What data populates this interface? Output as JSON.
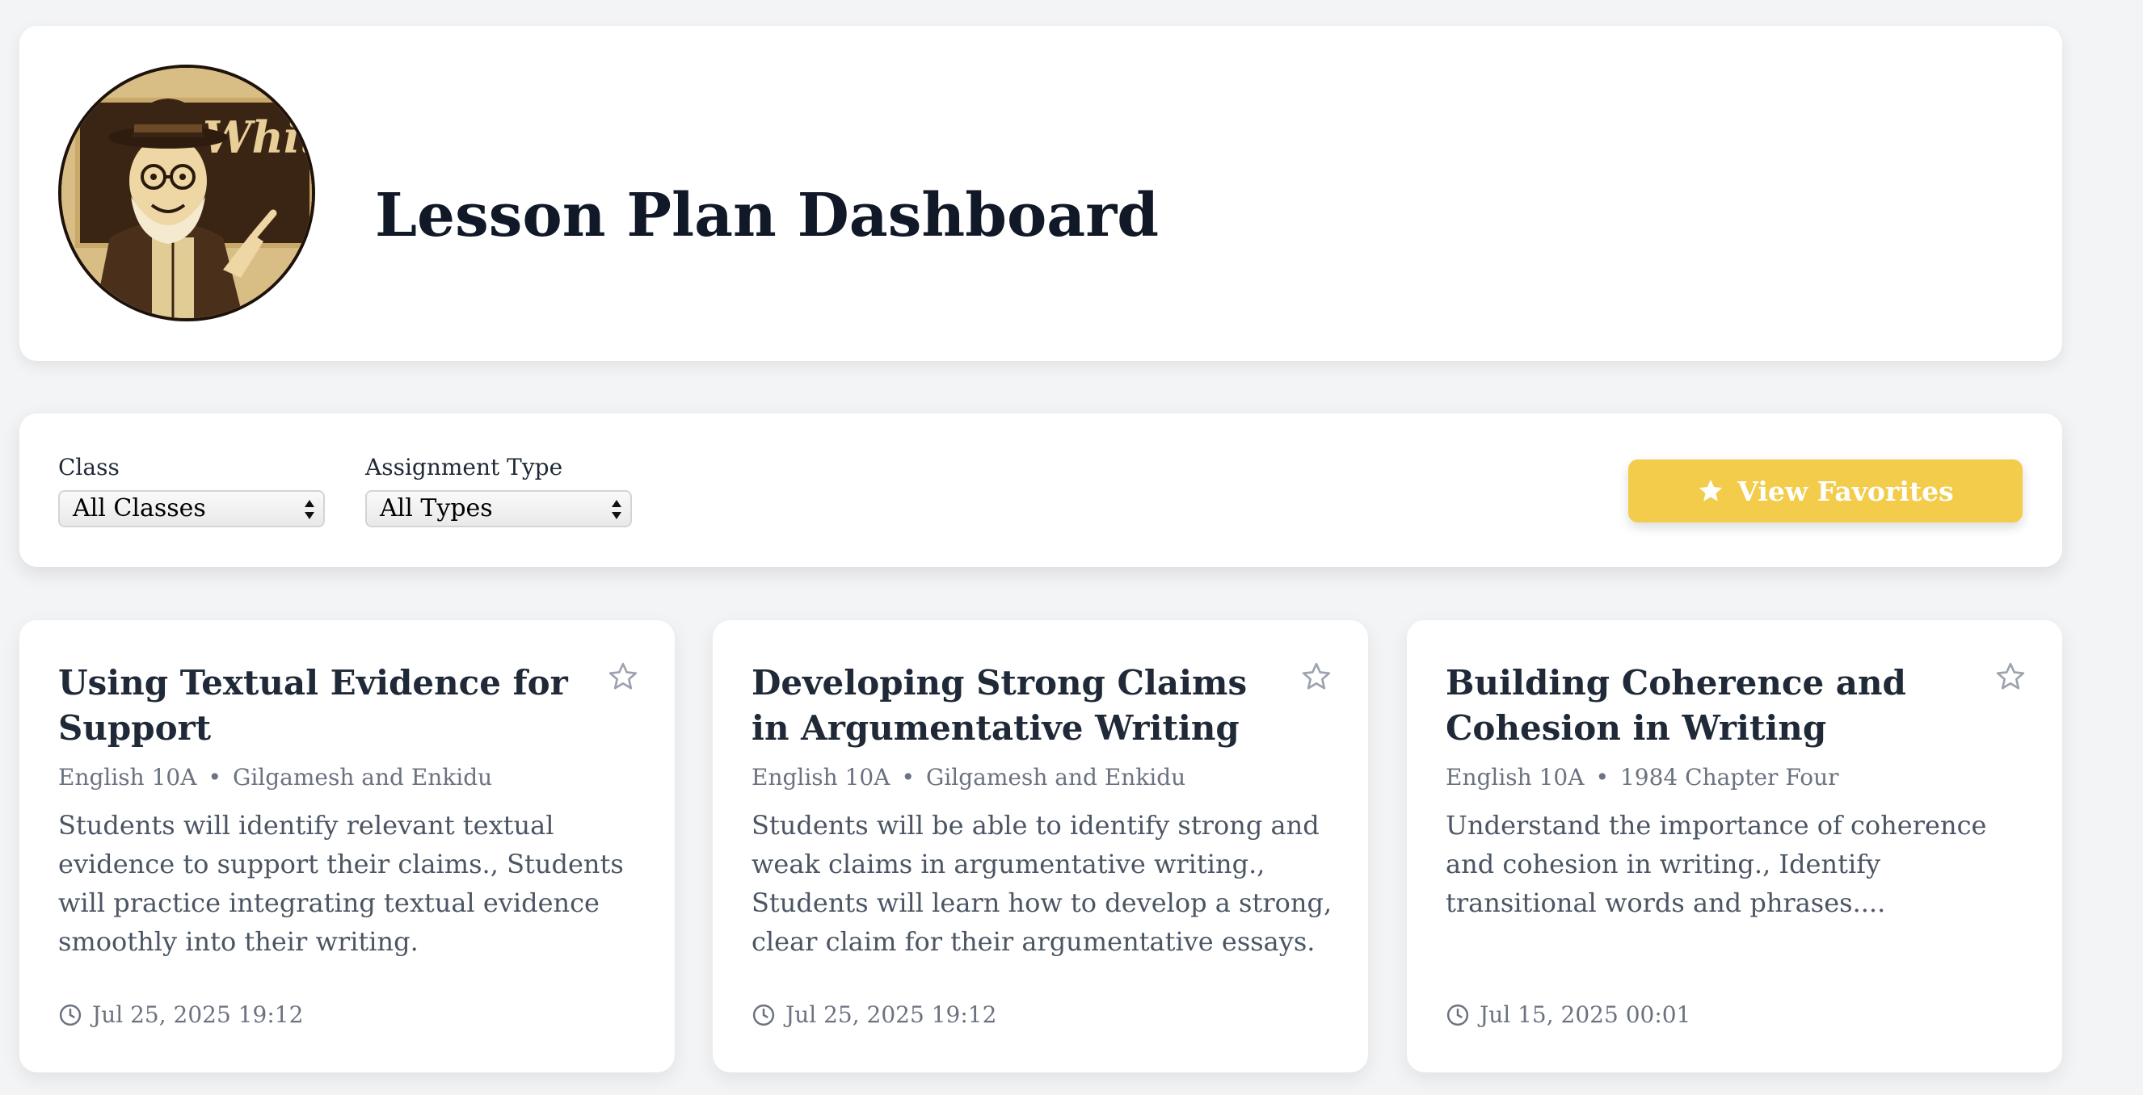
{
  "header": {
    "title": "Lesson Plan Dashboard",
    "logo_text": "Whit"
  },
  "filters": {
    "class_label": "Class",
    "class_value": "All Classes",
    "type_label": "Assignment Type",
    "type_value": "All Types",
    "favorites_label": "View Favorites"
  },
  "cards": [
    {
      "title": "Using Textual Evidence for Support",
      "class": "English 10A",
      "unit": "Gilgamesh and Enkidu",
      "description": "Students will identify relevant textual evidence to support their claims., Students will practice integrating textual evidence smoothly into their writing.",
      "date": "Jul 25, 2025 19:12"
    },
    {
      "title": "Developing Strong Claims in Argumentative Writing",
      "class": "English 10A",
      "unit": "Gilgamesh and Enkidu",
      "description": "Students will be able to identify strong and weak claims in argumentative writing., Students will learn how to develop a strong, clear claim for their argumentative essays.",
      "date": "Jul 25, 2025 19:12"
    },
    {
      "title": "Building Coherence and Cohesion in Writing",
      "class": "English 10A",
      "unit": "1984 Chapter Four",
      "description": "Understand the importance of coherence and cohesion in writing., Identify transitional words and phrases....",
      "date": "Jul 15, 2025 00:01"
    }
  ],
  "meta_separator": "•",
  "colors": {
    "accent": "#f2cc4a",
    "background": "#f3f4f6",
    "card": "#ffffff",
    "title": "#111827",
    "muted": "#6b7280"
  }
}
